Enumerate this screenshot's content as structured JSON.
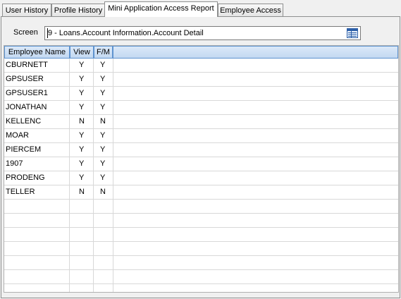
{
  "tabs": [
    {
      "label": "User History"
    },
    {
      "label": "Profile History"
    },
    {
      "label": "Mini Application Access Report"
    },
    {
      "label": "Employee Access"
    }
  ],
  "screen": {
    "label": "Screen",
    "value": "9 - Loans.Account Information.Account Detail"
  },
  "icons": {
    "list_button": "list-view-icon"
  },
  "colors": {
    "header_border": "#5e93cf",
    "header_bg": "#c3d9f1",
    "grid_line": "#d8d8d8"
  },
  "grid": {
    "columns": [
      "Employee Name",
      "View",
      "F/M"
    ],
    "rows": [
      {
        "name": "CBURNETT",
        "view": "Y",
        "fm": "Y"
      },
      {
        "name": "GPSUSER",
        "view": "Y",
        "fm": "Y"
      },
      {
        "name": "GPSUSER1",
        "view": "Y",
        "fm": "Y"
      },
      {
        "name": "JONATHAN",
        "view": "Y",
        "fm": "Y"
      },
      {
        "name": "KELLENC",
        "view": "N",
        "fm": "N"
      },
      {
        "name": "MOAR",
        "view": "Y",
        "fm": "Y"
      },
      {
        "name": "PIERCEM",
        "view": "Y",
        "fm": "Y"
      },
      {
        "name": "1907",
        "view": "Y",
        "fm": "Y"
      },
      {
        "name": "PRODENG",
        "view": "Y",
        "fm": "Y"
      },
      {
        "name": "TELLER",
        "view": "N",
        "fm": "N"
      }
    ]
  }
}
